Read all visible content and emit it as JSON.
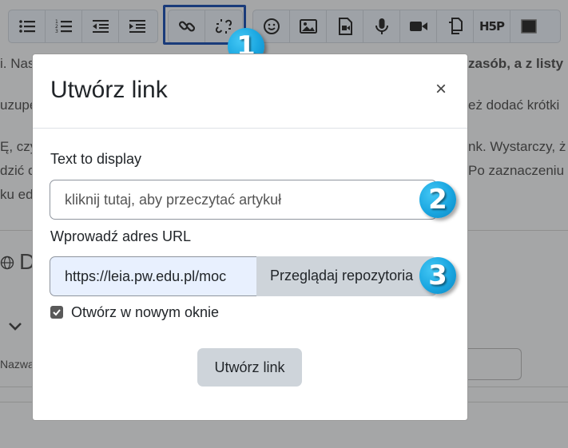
{
  "background": {
    "lines": [
      {
        "left": "i. Nas",
        "right": "zasób, a z listy"
      },
      {
        "left": "uzupe",
        "right": "eż dodać krótki"
      },
      {
        "left": "Ę, czy",
        "right": "nk. Wystarczy, ż"
      },
      {
        "left": "dzić c",
        "right": "Po zaznaczeniu"
      },
      {
        "left": "ku edy",
        "right": ""
      }
    ],
    "section_letter": "D",
    "name_label": "Nazwa"
  },
  "toolbar": {
    "groups": [
      [
        "unordered-list-icon",
        "ordered-list-icon",
        "outdent-icon",
        "indent-icon"
      ],
      [
        "link-icon",
        "unlink-icon"
      ],
      [
        "emoji-icon",
        "image-icon",
        "media-icon",
        "microphone-icon",
        "video-icon",
        "manage-files-icon",
        "h5p-icon",
        "black-square-icon"
      ]
    ],
    "h5p_label": "H5P"
  },
  "badges": [
    "1",
    "2",
    "3"
  ],
  "badge_color": "#1aa6e0",
  "highlight_color": "#1a3b7a",
  "dialog": {
    "title": "Utwórz link",
    "close_label": "×",
    "text_label": "Text to display",
    "text_value": "kliknij tutaj, aby przeczytać artykuł",
    "url_label": "Wprowadź adres URL",
    "url_value": "https://leia.pw.edu.pl/moc",
    "browse_label": "Przeglądaj repozytoria",
    "new_window_label": "Otwórz w nowym oknie",
    "new_window_checked": true,
    "submit_label": "Utwórz link"
  }
}
